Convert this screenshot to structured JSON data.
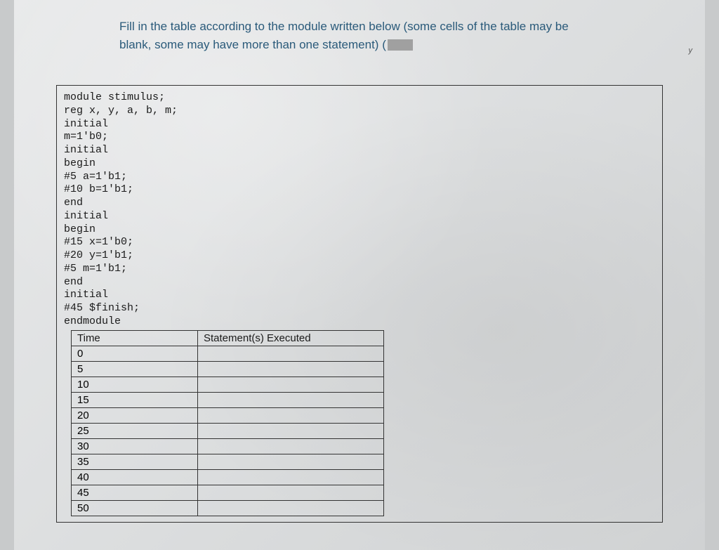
{
  "instruction": {
    "line1": "Fill in the table according to the module written below (some cells of the table may be",
    "line2": "blank, some may have more than one statement) ("
  },
  "corner_mark": "y",
  "code_lines": [
    "module stimulus;",
    "reg x, y, a, b, m;",
    "initial",
    "m=1'b0;",
    "initial",
    "begin",
    "#5 a=1'b1;",
    "#10 b=1'b1;",
    "end",
    "initial",
    "begin",
    "#15 x=1'b0;",
    "#20 y=1'b1;",
    "#5 m=1'b1;",
    "end",
    "initial",
    "#45 $finish;",
    "endmodule"
  ],
  "table": {
    "headers": {
      "time": "Time",
      "stmt": "Statement(s) Executed"
    },
    "rows": [
      {
        "time": "0",
        "stmt": ""
      },
      {
        "time": "5",
        "stmt": ""
      },
      {
        "time": "10",
        "stmt": ""
      },
      {
        "time": "15",
        "stmt": ""
      },
      {
        "time": "20",
        "stmt": ""
      },
      {
        "time": "25",
        "stmt": ""
      },
      {
        "time": "30",
        "stmt": ""
      },
      {
        "time": "35",
        "stmt": ""
      },
      {
        "time": "40",
        "stmt": ""
      },
      {
        "time": "45",
        "stmt": ""
      },
      {
        "time": "50",
        "stmt": ""
      }
    ]
  }
}
